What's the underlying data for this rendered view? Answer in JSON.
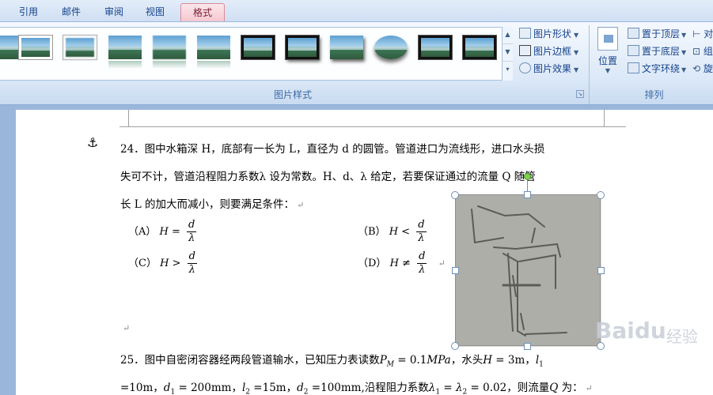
{
  "tabs": [
    {
      "label": "引用",
      "active": false
    },
    {
      "label": "邮件",
      "active": false
    },
    {
      "label": "审阅",
      "active": false
    },
    {
      "label": "视图",
      "active": false
    },
    {
      "label": "格式",
      "active": true
    }
  ],
  "picture_styles": {
    "group_label": "图片样式",
    "thumbnails": [
      "plain",
      "white-frame",
      "soft-edge",
      "reflected",
      "reflected-soft",
      "soft-shadow",
      "black-frame-thick",
      "black-frame-shadow",
      "shadow",
      "oval",
      "black-frame",
      "black-frame-thin"
    ],
    "commands": [
      {
        "label": "图片形状",
        "icon": "picture-shape-icon"
      },
      {
        "label": "图片边框",
        "icon": "picture-border-icon"
      },
      {
        "label": "图片效果",
        "icon": "picture-effects-icon"
      }
    ]
  },
  "arrange": {
    "group_label": "排列",
    "position_label": "位置",
    "commands": [
      {
        "label": "置于顶层",
        "icon": "bring-to-front-icon"
      },
      {
        "label": "置于底层",
        "icon": "send-to-back-icon"
      },
      {
        "label": "文字环绕",
        "icon": "text-wrap-icon"
      }
    ],
    "cut_off": [
      "对",
      "组",
      "旋"
    ]
  },
  "document": {
    "q24": {
      "line1": "24．图中水箱深 H，底部有一长为 L，直径为 d 的圆管。管道进口为流线形，进口水头损",
      "line2": "失可不计，管道沿程阻力系数λ 设为常数。H、d、λ 给定，若要保证通过的流量 Q 随管",
      "line3": "长 L 的加大而减小，则要满足条件：",
      "options": [
        {
          "label": "（A）",
          "lhs": "H =",
          "num": "d",
          "den": "λ"
        },
        {
          "label": "（B）",
          "lhs": "H <",
          "num": "d",
          "den": "λ"
        },
        {
          "label": "（C）",
          "lhs": "H >",
          "num": "d",
          "den": "λ"
        },
        {
          "label": "（D）",
          "lhs": "H ≠",
          "num": "d",
          "den": "λ"
        }
      ]
    },
    "q25": {
      "line1_a": "25．图中自密闭容器经两段管道输水，已知压力表读数",
      "line1_p": "P",
      "line1_psub": "M",
      "line1_b": " = 0.1",
      "line1_unit": "MPa",
      "line1_c": "，水头",
      "line1_h": "H",
      "line1_d": " = 3m，",
      "line1_l": "l",
      "line1_lsub": "1",
      "line2_a": "=10m，",
      "line2_d1": "d",
      "line2_d1sub": "1",
      "line2_b": " = 200mm，",
      "line2_l2": "l",
      "line2_l2sub": "2",
      "line2_c": " =15m，",
      "line2_d2": "d",
      "line2_d2sub": "2",
      "line2_d": " =100mm,沿程阻力系数",
      "line2_lam1": "λ",
      "line2_lam1sub": "1",
      "line2_e": " = ",
      "line2_lam2": "λ",
      "line2_lam2sub": "2",
      "line2_f": " = 0.02，则流量",
      "line2_q": "Q",
      "line2_g": " 为："
    },
    "paragraph_mark": "↵",
    "anchor_symbol": "⚓"
  },
  "watermark": {
    "brand": "Baidu",
    "sub": "经验"
  }
}
